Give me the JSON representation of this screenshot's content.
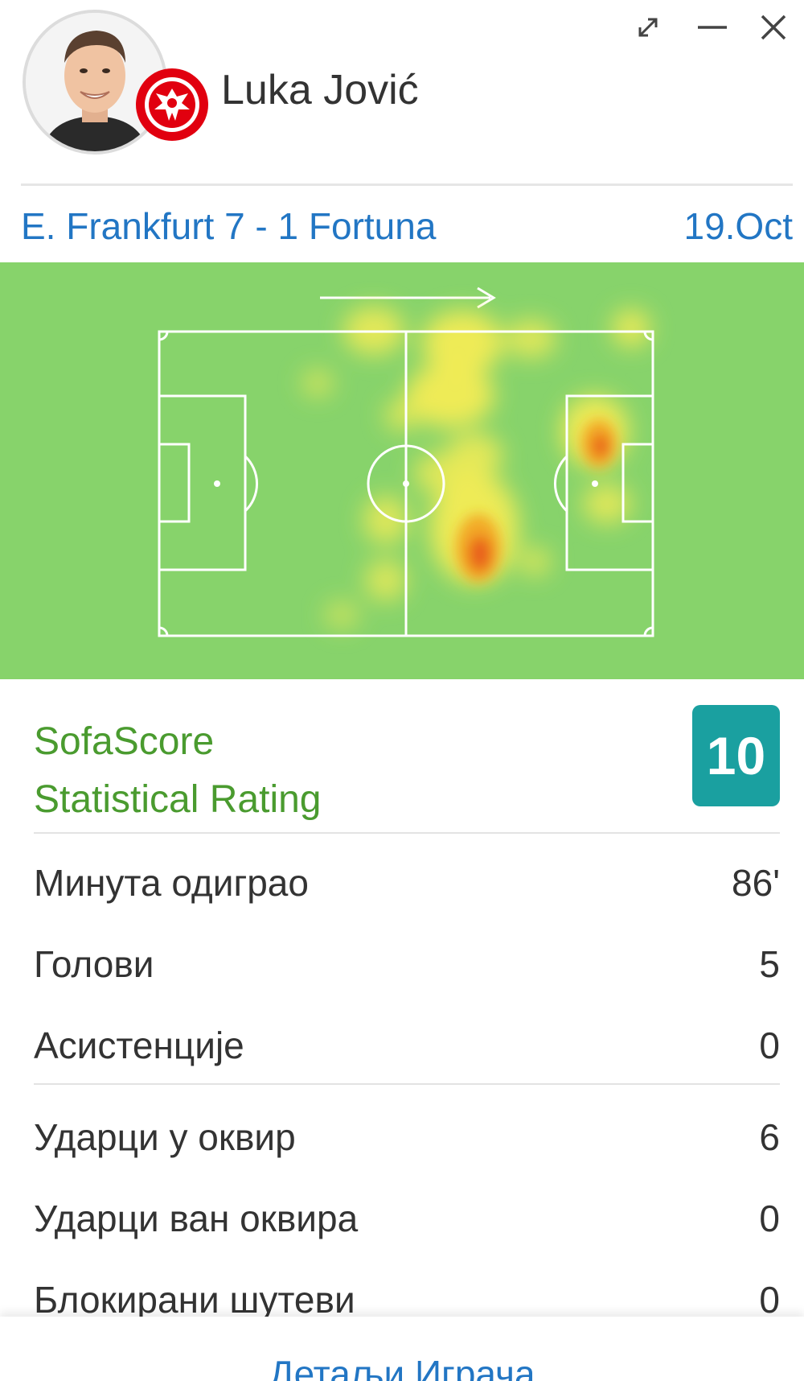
{
  "player": {
    "name": "Luka Jović"
  },
  "window_controls": {
    "expand_icon": "expand-icon",
    "minimize_icon": "minimize-icon",
    "close_icon": "close-icon"
  },
  "match": {
    "title": "E. Frankfurt 7 - 1 Fortuna",
    "date": "19.Oct"
  },
  "heatmap": {
    "pitch_color": "#87d36b",
    "direction": "attacking-right"
  },
  "rating": {
    "line1": "SofaScore",
    "line2": "Statistical Rating",
    "value": "10",
    "badge_color": "#1aa0a0"
  },
  "stats": [
    {
      "label": "Минута одиграо",
      "value": "86'"
    },
    {
      "label": "Голови",
      "value": "5"
    },
    {
      "label": "Асистенције",
      "value": "0"
    },
    {
      "label": "Ударци у оквир",
      "value": "6"
    },
    {
      "label": "Ударци ван оквира",
      "value": "0"
    },
    {
      "label": "Блокирани шутеви",
      "value": "0"
    }
  ],
  "footer": {
    "details_link": "Детаљи Играча"
  },
  "colors": {
    "link": "#2276c4",
    "rating_title": "#4a9b2f"
  }
}
